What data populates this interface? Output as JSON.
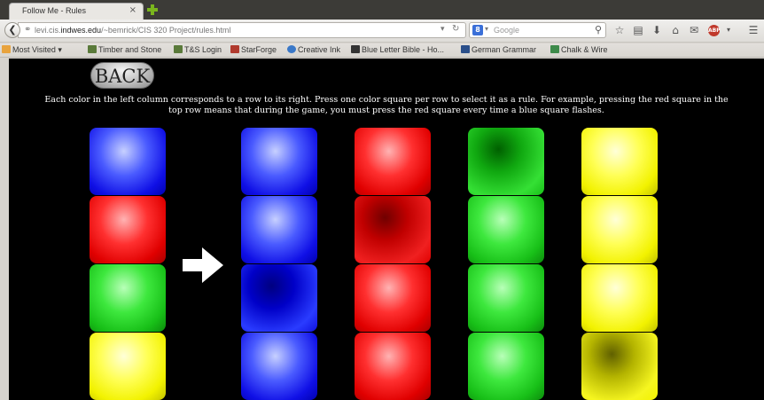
{
  "browser": {
    "tab_title": "Follow Me - Rules",
    "tab_close": "×",
    "url_prefix": "levi.cis.",
    "url_domain": "indwes.edu",
    "url_path": "/~bemrick/CIS 320 Project/rules.html",
    "search_placeholder": "Google",
    "search_engine_letter": "8"
  },
  "bookmarks": [
    {
      "label": "Most Visited ▾",
      "icon_color": "#e8a33d"
    },
    {
      "label": "Timber and Stone",
      "icon_color": "#5a7a3a"
    },
    {
      "label": "T&S Login",
      "icon_color": "#5a7a3a"
    },
    {
      "label": "StarForge",
      "icon_color": "#b03a2e"
    },
    {
      "label": "Creative Ink",
      "icon_color": "#3a78c8"
    },
    {
      "label": "Blue Letter Bible - Ho...",
      "icon_color": "#333333"
    },
    {
      "label": "German Grammar",
      "icon_color": "#2b4f8a"
    },
    {
      "label": "Chalk & Wire",
      "icon_color": "#3d8a4a"
    }
  ],
  "page": {
    "back_label": "BACK",
    "instructions_line1": "Each color in the left column corresponds to a row to its right. Press one color square per row to select it as a rule. For example, pressing the red square in the",
    "instructions_line2": "top row means that during the game, you must press the red square every time a blue square flashes."
  },
  "grid": {
    "row_colors": [
      "blue",
      "red",
      "green",
      "yellow"
    ],
    "columns": [
      "blue",
      "red",
      "green",
      "yellow"
    ],
    "selected_column_per_row": [
      "green",
      "red",
      "blue",
      "yellow"
    ]
  },
  "colors": {
    "blue": "#1010e6",
    "red": "#e00000",
    "green": "#18c018",
    "yellow": "#f2f200"
  }
}
